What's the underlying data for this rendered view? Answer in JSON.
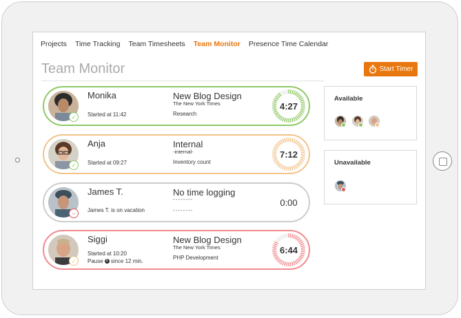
{
  "nav": [
    {
      "label": "Projects",
      "active": false
    },
    {
      "label": "Time Tracking",
      "active": false
    },
    {
      "label": "Team Timesheets",
      "active": false
    },
    {
      "label": "Team Monitor",
      "active": true
    },
    {
      "label": "Presence Time Calendar",
      "active": false
    }
  ],
  "page_title": "Team Monitor",
  "start_timer_label": "Start Timer",
  "members": [
    {
      "name": "Monika",
      "sub1": "Started at 11:42",
      "sub2": "",
      "project": "New Blog Design",
      "client": "The New York Times",
      "task": "Research",
      "time": "4:27",
      "color": "#8dc865",
      "status": "active"
    },
    {
      "name": "Anja",
      "sub1": "Started at 09:27",
      "sub2": "",
      "project": "Internal",
      "client": "-internal-",
      "task": "Inventory count",
      "time": "7:12",
      "color": "#f0c38a",
      "status": "active"
    },
    {
      "name": "James T.",
      "sub1": "James T. is on vacation",
      "sub2": "",
      "project": "No time logging",
      "client": "--------",
      "task": "--------",
      "time": "0:00",
      "color": "#cccccc",
      "status": "unavailable"
    },
    {
      "name": "Siggi",
      "sub1": "Started at 10:20",
      "sub2": "Pause",
      "sub2b": "since 12 min.",
      "project": "New Blog Design",
      "client": "The New York Times",
      "task": "PHP Development",
      "time": "6:44",
      "color": "#f0898e",
      "status": "pause"
    }
  ],
  "available": {
    "title": "Available"
  },
  "unavailable": {
    "title": "Unavailable"
  },
  "colors": {
    "accent": "#e8770f",
    "green": "#8dc865",
    "peach": "#f0c38a",
    "grey": "#cccccc",
    "red": "#f0898e"
  }
}
